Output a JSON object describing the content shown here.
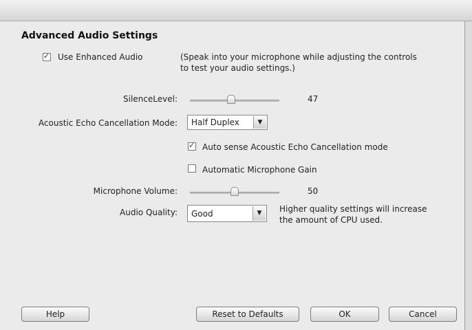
{
  "dialog": {
    "title": "Advanced Audio Settings",
    "enhanced_audio": {
      "label": "Use Enhanced Audio",
      "checked": true
    },
    "hint_line1": "(Speak into your microphone while adjusting the controls",
    "hint_line2": "to test your audio settings.)",
    "silence": {
      "label": "SilenceLevel:",
      "value": "47",
      "level": 47
    },
    "aec": {
      "label": "Acoustic Echo Cancellation Mode:",
      "selected": "Half Duplex"
    },
    "auto_sense": {
      "label": "Auto sense Acoustic Echo Cancellation mode",
      "checked": true
    },
    "auto_gain": {
      "label": "Automatic Microphone Gain",
      "checked": false
    },
    "mic_volume": {
      "label": "Microphone Volume:",
      "value": "50",
      "level": 50
    },
    "quality": {
      "label": "Audio Quality:",
      "selected": "Good",
      "note_line1": "Higher quality settings will increase",
      "note_line2": "the amount of CPU used."
    },
    "buttons": {
      "help": "Help",
      "reset": "Reset to Defaults",
      "ok": "OK",
      "cancel": "Cancel"
    }
  }
}
